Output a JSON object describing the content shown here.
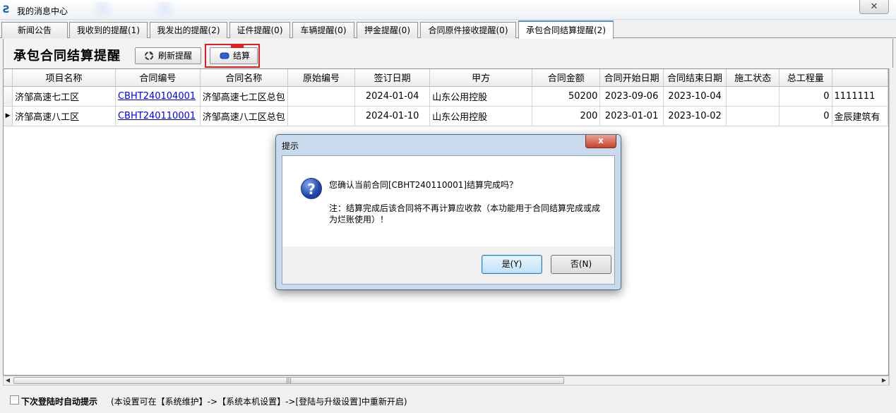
{
  "window": {
    "title": "我的消息中心",
    "close_glyph": "✕"
  },
  "tabs": [
    {
      "label": "新闻公告",
      "active": false
    },
    {
      "label": "我收到的提醒(1)",
      "active": false
    },
    {
      "label": "我发出的提醒(2)",
      "active": false
    },
    {
      "label": "证件提醒(0)",
      "active": false
    },
    {
      "label": "车辆提醒(0)",
      "active": false
    },
    {
      "label": "押金提醒(0)",
      "active": false
    },
    {
      "label": "合同原件接收提醒(0)",
      "active": false
    },
    {
      "label": "承包合同结算提醒(2)",
      "active": true
    }
  ],
  "panel": {
    "title": "承包合同结算提醒",
    "refresh_label": "刷新提醒",
    "settle_label": "结算"
  },
  "grid": {
    "columns": [
      "项目名称",
      "合同编号",
      "合同名称",
      "原始编号",
      "签订日期",
      "甲方",
      "合同金额",
      "合同开始日期",
      "合同结束日期",
      "施工状态",
      "总工程量",
      ""
    ],
    "rows": [
      [
        "济邹高速七工区",
        "CBHT240104001",
        "济邹高速七工区总包",
        "",
        "2024-01-04",
        "山东公用控股",
        "50200",
        "2023-09-06",
        "2023-10-04",
        "",
        "0",
        "1111111"
      ],
      [
        "济邹高速八工区",
        "CBHT240110001",
        "济邹高速八工区总包",
        "",
        "2024-01-10",
        "山东公用控股",
        "200",
        "2023-01-01",
        "2023-10-02",
        "",
        "0",
        "金辰建筑有"
      ]
    ],
    "current_row_marker": "▶"
  },
  "footer": {
    "checkbox_checked": false,
    "bold_label": "下次登陆时自动提示",
    "note": "(本设置可在【系统维护】->【系统本机设置】->[登陆与升级设置]中重新开启)"
  },
  "dialog": {
    "title": "提示",
    "close_glyph": "x",
    "icon_glyph": "?",
    "message": "您确认当前合同[CBHT240110001]结算完成吗？",
    "note": "注：结算完成后该合同将不再计算应收款（本功能用于合同结算完成或成为烂账使用）！",
    "yes_label": "是(Y)",
    "no_label": "否(N)"
  },
  "colors": {
    "highlight": "#e11d1d",
    "link": "#0000ee",
    "active_tab_accent": "#4a8ed6"
  }
}
